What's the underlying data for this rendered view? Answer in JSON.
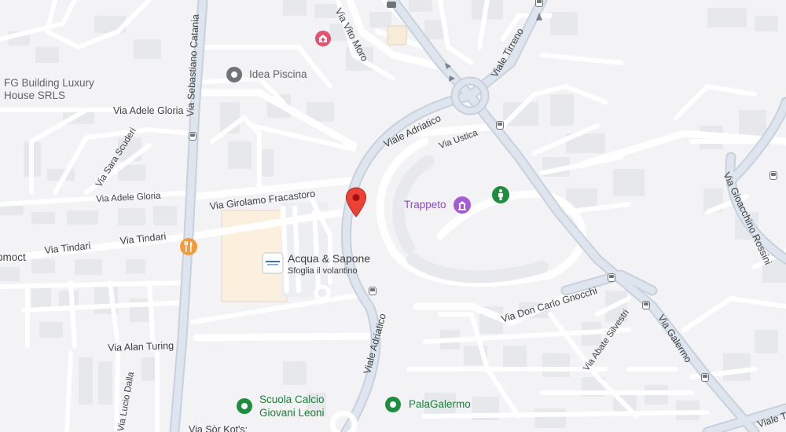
{
  "map": {
    "colors": {
      "background": "#f3f3f5",
      "road": "#ffffff",
      "major_road": "#cfd8e3",
      "building": "#e7e9ec",
      "parking": "#fdf1df",
      "marker_red": "#e53935",
      "poi_purple": "#8e44c9",
      "poi_green": "#1e8e3e",
      "poi_orange": "#f29b38",
      "poi_gray": "#5f6368"
    },
    "roads": {
      "via_vito_moro": "Via Vito Moro",
      "viale_tirreno": "Viale Tirreno",
      "via_sebastiano_catania": "Via Sebastiano Catania",
      "via_adele_gloria_top": "Via Adele Gloria",
      "via_sara_scuderi": "Via Sara Scuderi",
      "via_adele_gloria_bottom": "Via Adele Gloria",
      "viale_adriatico_top": "Viale Adriatico",
      "via_ustica": "Via Ustica",
      "via_girolamo_fracastoro": "Via Girolamo Fracastoro",
      "via_tindari_left": "Via Tindari",
      "via_tindari_right": "Via Tindari",
      "via_alan_turing": "Via Alan Turing",
      "viale_adriatico_bottom": "Viale Adriatico",
      "via_don_carlo_gnocchi": "Via Don Carlo Gnocchi",
      "via_abate_silvestri": "Via Abate Silvestri",
      "via_galermo": "Via Galermo",
      "via_gioacchino_rossini": "Via Gioacchino Rossini",
      "via_lucio_dalla": "Via Lucio Dalla",
      "viale_bottom_right": "Viale T",
      "via_bottom": "Via Sòr Kot's: "
    },
    "pois": {
      "fg_building_line1": "FG Building Luxury",
      "fg_building_line2": "House SRLS",
      "idea_piscina": "Idea Piscina",
      "trappeto": "Trappeto",
      "acqua_sapone": "Acqua & Sapone",
      "acqua_sapone_sub": "Sfoglia il volantino",
      "scuola_calcio_line1": "Scuola Calcio",
      "scuola_calcio_line2": "Giovani Leoni",
      "palagalermo": "PalaGalermo",
      "left_edge": "omoct"
    },
    "icons": {
      "hospital": "hospital-icon",
      "idea_piscina": "pin-gray-icon",
      "trappeto": "monument-icon",
      "restaurant": "restaurant-icon",
      "park": "park-icon",
      "school": "sports-icon",
      "palagalermo": "sports-icon",
      "acqua_sapone_logo": "store-logo-icon",
      "selected_marker": "red-pin-icon",
      "bus": "bus-stop-icon"
    }
  }
}
